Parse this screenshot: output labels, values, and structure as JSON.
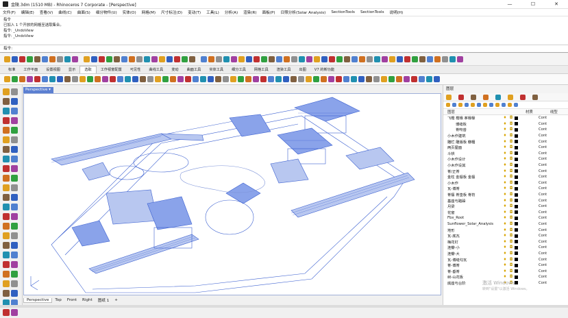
{
  "window": {
    "title": "金陵.3dm (1510 MB) - Rhinoceros 7 Corporate - [Perspective]",
    "buttons": [
      "—",
      "☐",
      "✕"
    ]
  },
  "menu": [
    "文件(F)",
    "编辑(E)",
    "查看(V)",
    "曲线(C)",
    "曲面(S)",
    "细分物件(U)",
    "实体(O)",
    "网格(M)",
    "尺寸标注(D)",
    "变动(T)",
    "工具(L)",
    "分析(A)",
    "渲染(R)",
    "面板(P)",
    "日照分析(Solar Analysis)",
    "SectionTools",
    "SectionTools",
    "说明(H)"
  ],
  "command_history": [
    "指令",
    "已加入 1 个开放的网格至选取集合。",
    "指令: _UndoView",
    "指令: _UndoView"
  ],
  "command_prompt": "指令:",
  "ribbon_tabs": [
    "标准",
    "工作平面",
    "设置视图",
    "显示",
    "选取",
    "工作视窗配置",
    "可见性",
    "曲线工具",
    "变动",
    "曲面工具",
    "实体工具",
    "细分工具",
    "网格工具",
    "渲染工具",
    "出图",
    "V7 的新功能"
  ],
  "active_ribbon_tab": "选取",
  "viewport": {
    "name": "Perspective"
  },
  "view_tabs": [
    "Perspective",
    "Top",
    "Front",
    "Right",
    "图纸 1",
    "+"
  ],
  "active_view_tab": "Perspective",
  "panel": {
    "title": "图层",
    "headers": {
      "name": "图层",
      "material": "材质",
      "linetype": "线型"
    },
    "layers": [
      {
        "name": "飞檐 檐椽 茅椽椽",
        "linetype": "Cont",
        "indent": 0,
        "expanded": true
      },
      {
        "name": "博缝板",
        "linetype": "Cont",
        "indent": 2
      },
      {
        "name": "脊吻兽",
        "linetype": "Cont",
        "indent": 2
      },
      {
        "name": "小木作建筑",
        "linetype": "Cont",
        "indent": 0
      },
      {
        "name": "雕栏 雕版板 瓣楣",
        "linetype": "Cont",
        "indent": 0
      },
      {
        "name": "两页屋面",
        "linetype": "Cont",
        "indent": 0
      },
      {
        "name": "斗栱",
        "linetype": "Cont",
        "indent": 0
      },
      {
        "name": "小木作设计",
        "linetype": "Cont",
        "indent": 0
      },
      {
        "name": "小木作设其",
        "linetype": "Cont",
        "indent": 0
      },
      {
        "name": "脊/正脊",
        "linetype": "Cont",
        "indent": 0
      },
      {
        "name": "金柱 金檩板 金檩",
        "linetype": "Cont",
        "indent": 0
      },
      {
        "name": "小木作",
        "linetype": "Cont",
        "indent": 0
      },
      {
        "name": "瓦-博脊",
        "linetype": "Cont",
        "indent": 0
      },
      {
        "name": "脊檩 脊垫板 脊枋",
        "linetype": "Cont",
        "indent": 0
      },
      {
        "name": "基座与踏跺",
        "linetype": "Cont",
        "indent": 0
      },
      {
        "name": "月梁",
        "linetype": "Cont",
        "indent": 0
      },
      {
        "name": "花窗",
        "linetype": "Cont",
        "indent": 0
      },
      {
        "name": "Fbx_Root",
        "linetype": "Cont",
        "indent": 0
      },
      {
        "name": "Sunflower_Solar_Analysis",
        "linetype": "Cont",
        "indent": 0
      },
      {
        "name": "地形",
        "linetype": "Cont",
        "indent": 0
      },
      {
        "name": "瓦-底瓦",
        "linetype": "Cont",
        "indent": 0
      },
      {
        "name": "梅花钉",
        "linetype": "Cont",
        "indent": 0
      },
      {
        "name": "连瓣-小",
        "linetype": "Cont",
        "indent": 0
      },
      {
        "name": "连瓣-大",
        "linetype": "Cont",
        "indent": 0
      },
      {
        "name": "瓦-博缝勾瓦",
        "linetype": "Cont",
        "indent": 0
      },
      {
        "name": "脊-博脊",
        "linetype": "Cont",
        "indent": 0
      },
      {
        "name": "脊-垂脊",
        "linetype": "Cont",
        "indent": 0
      },
      {
        "name": "树-山花板",
        "linetype": "Cont",
        "indent": 0
      },
      {
        "name": "底座与台阶",
        "linetype": "Cont",
        "indent": 0
      }
    ]
  },
  "watermark": {
    "line1": "激活 Windows",
    "line2": "转到\"设置\"以激活 Windows。"
  },
  "colors": {
    "viewport_lines": "#3a5fd0",
    "viewport_tab": "#5b7fd1"
  }
}
